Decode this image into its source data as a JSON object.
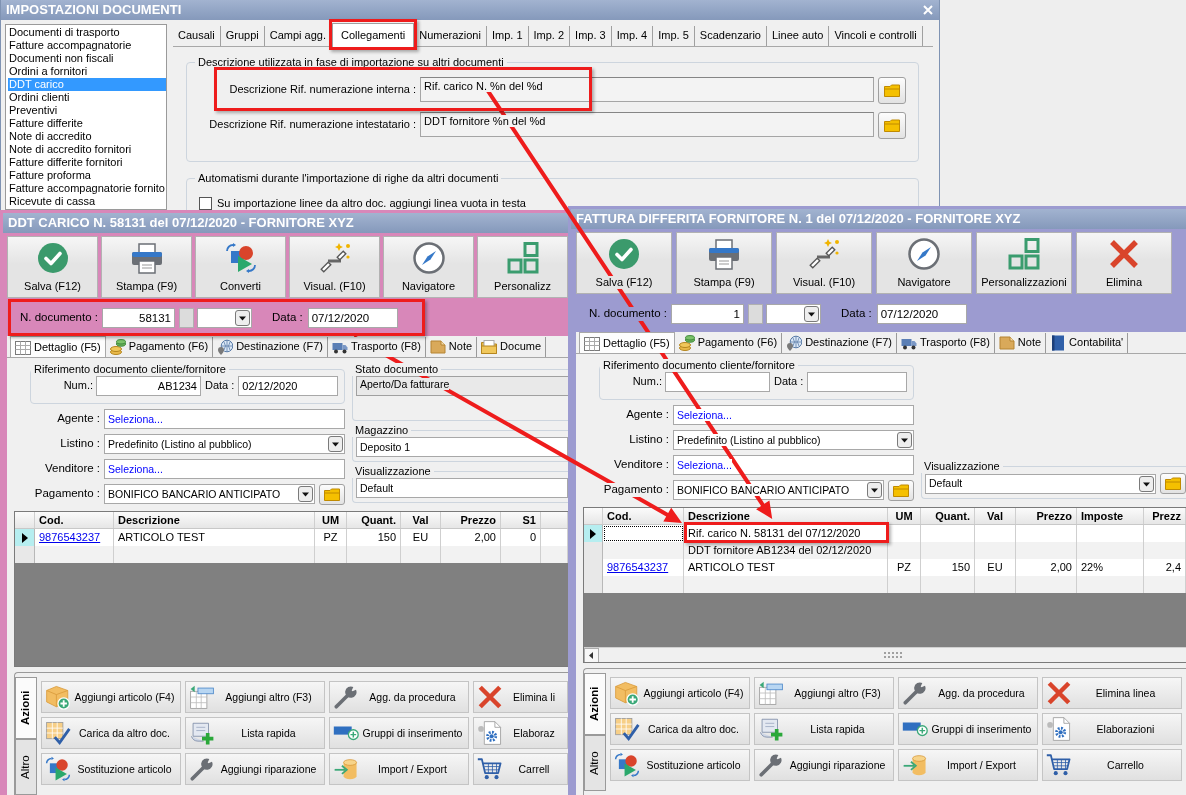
{
  "settings_window": {
    "title": "IMPOSTAZIONI DOCUMENTI",
    "document_types": [
      {
        "label": "Documenti di trasporto",
        "selected": false
      },
      {
        "label": "Fatture accompagnatorie",
        "selected": false
      },
      {
        "label": "Documenti non fiscali",
        "selected": false
      },
      {
        "label": "Ordini a fornitori",
        "selected": false
      },
      {
        "label": "DDT carico",
        "selected": true
      },
      {
        "label": "Ordini clienti",
        "selected": false
      },
      {
        "label": "Preventivi",
        "selected": false
      },
      {
        "label": "Fatture differite",
        "selected": false
      },
      {
        "label": "Note di accredito",
        "selected": false
      },
      {
        "label": "Note di accredito fornitori",
        "selected": false
      },
      {
        "label": "Fatture differite fornitori",
        "selected": false
      },
      {
        "label": "Fatture proforma",
        "selected": false
      },
      {
        "label": "Fatture accompagnatorie fornito",
        "selected": false
      },
      {
        "label": "Ricevute di cassa",
        "selected": false
      }
    ],
    "tabs": [
      {
        "label": "Causali",
        "selected": false,
        "highlighted": false
      },
      {
        "label": "Gruppi",
        "selected": false,
        "highlighted": false
      },
      {
        "label": "Campi agg.",
        "selected": false,
        "highlighted": false
      },
      {
        "label": "Collegamenti",
        "selected": true,
        "highlighted": true
      },
      {
        "label": "Numerazioni",
        "selected": false,
        "highlighted": false
      },
      {
        "label": "Imp. 1",
        "selected": false,
        "highlighted": false
      },
      {
        "label": "Imp. 2",
        "selected": false,
        "highlighted": false
      },
      {
        "label": "Imp. 3",
        "selected": false,
        "highlighted": false
      },
      {
        "label": "Imp. 4",
        "selected": false,
        "highlighted": false
      },
      {
        "label": "Imp. 5",
        "selected": false,
        "highlighted": false
      },
      {
        "label": "Scadenzario",
        "selected": false,
        "highlighted": false
      },
      {
        "label": "Linee auto",
        "selected": false,
        "highlighted": false
      },
      {
        "label": "Vincoli e controlli",
        "selected": false,
        "highlighted": false
      }
    ],
    "groups": [
      {
        "title": "Descrizione utilizzata in fase di importazione su altri documenti",
        "fields": [
          {
            "label": "Descrizione Rif. numerazione interna :",
            "value": "Rif. carico N. %n del %d",
            "highlighted": true,
            "arrow": true
          },
          {
            "label": "Descrizione Rif. numerazione intestatario :",
            "value": "DDT fornitore %n del %d",
            "highlighted": false,
            "arrow": false
          }
        ]
      },
      {
        "title": "Automatismi durante l'importazione di righe da altri documenti",
        "checkboxes": [
          {
            "label": "Su importazione linee da altro doc. aggiungi linea vuota in testa",
            "checked": false
          }
        ]
      }
    ]
  },
  "document_windows": [
    {
      "title": "DDT CARICO N. 58131 del 07/12/2020 - FORNITORE XYZ",
      "color": "#d887b9",
      "toolbar": [
        "Salva (F12)",
        "Stampa (F9)",
        "Converti",
        "Visual. (F10)",
        "Navigatore",
        "Personalizz"
      ],
      "header": {
        "number_label": "N. documento :",
        "number": "58131",
        "date_label": "Data :",
        "date": "07/12/2020",
        "highlighted": true,
        "arrow": true
      },
      "tabs": [
        {
          "label": "Dettaglio (F5)",
          "selected": true
        },
        {
          "label": "Pagamento (F6)",
          "selected": false
        },
        {
          "label": "Destinazione (F7)",
          "selected": false
        },
        {
          "label": "Trasporto (F8)",
          "selected": false
        },
        {
          "label": "Note",
          "selected": false
        },
        {
          "label": "Docume",
          "selected": false
        }
      ],
      "reference": {
        "title": "Riferimento documento cliente/fornitore",
        "number_label": "Num.:",
        "number": "AB1234",
        "date_label": "Data :",
        "date": "02/12/2020"
      },
      "fields": [
        {
          "label": "Agente :",
          "value": "Seleziona...",
          "kind": "selector"
        },
        {
          "label": "Listino :",
          "value": "Predefinito (Listino al pubblico)",
          "kind": "dropdown"
        },
        {
          "label": "Venditore :",
          "value": "Seleziona...",
          "kind": "selector"
        },
        {
          "label": "Pagamento :",
          "value": "BONIFICO BANCARIO ANTICIPATO",
          "kind": "dropdown",
          "folder_button": true
        }
      ],
      "side_groups": [
        {
          "title": "Stato documento",
          "value": "Aperto/Da fatturare",
          "kind": "readonly"
        },
        {
          "title": "Magazzino",
          "value": "Deposito 1",
          "kind": "field"
        },
        {
          "title": "Visualizzazione",
          "value": "Default",
          "kind": "field"
        }
      ],
      "grid": {
        "columns": [
          {
            "label": "Cod.",
            "kind": "link"
          },
          {
            "label": "Descrizione",
            "kind": "text"
          },
          {
            "label": "UM",
            "kind": "center"
          },
          {
            "label": "Quant.",
            "kind": "number"
          },
          {
            "label": "Val",
            "kind": "center"
          },
          {
            "label": "Prezzo",
            "kind": "number"
          },
          {
            "label": "S1",
            "kind": "number"
          }
        ],
        "rows": [
          {
            "current": true,
            "highlighted": false,
            "cells": [
              "9876543237",
              "ARTICOLO TEST",
              "PZ",
              "150",
              "EU",
              "2,00",
              "0"
            ]
          },
          {
            "current": false,
            "highlighted": false
          }
        ]
      },
      "action_tabs": [
        {
          "label": "Azioni",
          "selected": true
        },
        {
          "label": "Altro",
          "selected": false
        }
      ],
      "actions": [
        "Aggiungi articolo (F4)",
        "Aggiungi altro (F3)",
        "Agg. da procedura",
        "Elimina li",
        "Carica da altro doc.",
        "Lista rapida",
        "Gruppi di inserimento",
        "Elaboraz",
        "Sostituzione articolo",
        "Aggiungi riparazione",
        "Import / Export",
        "Carrell"
      ]
    },
    {
      "title": "FATTURA DIFFERITA FORNITORE N. 1 del 07/12/2020 - FORNITORE XYZ",
      "color": "#9c9bd0",
      "toolbar": [
        "Salva (F12)",
        "Stampa (F9)",
        "Visual. (F10)",
        "Navigatore",
        "Personalizzazioni",
        "Elimina"
      ],
      "header": {
        "number_label": "N. documento :",
        "number": "1",
        "date_label": "Data :",
        "date": "07/12/2020",
        "highlighted": false,
        "arrow": false
      },
      "tabs": [
        {
          "label": "Dettaglio (F5)",
          "selected": true
        },
        {
          "label": "Pagamento (F6)",
          "selected": false
        },
        {
          "label": "Destinazione (F7)",
          "selected": false
        },
        {
          "label": "Trasporto (F8)",
          "selected": false
        },
        {
          "label": "Note",
          "selected": false
        },
        {
          "label": "Contabilita'",
          "selected": false
        }
      ],
      "reference": {
        "title": "Riferimento documento cliente/fornitore",
        "number_label": "Num.:",
        "date_label": "Data :"
      },
      "fields": [
        {
          "label": "Agente :",
          "value": "Seleziona...",
          "kind": "selector"
        },
        {
          "label": "Listino :",
          "value": "Predefinito (Listino al pubblico)",
          "kind": "dropdown"
        },
        {
          "label": "Venditore :",
          "value": "Seleziona...",
          "kind": "selector"
        },
        {
          "label": "Pagamento :",
          "value": "BONIFICO BANCARIO ANTICIPATO",
          "kind": "dropdown",
          "folder_button": true
        }
      ],
      "side_groups": [
        {
          "title": "Visualizzazione",
          "value": "Default",
          "kind": "dropdown",
          "folder_button": true
        }
      ],
      "grid": {
        "columns": [
          {
            "label": "Cod.",
            "kind": "link"
          },
          {
            "label": "Descrizione",
            "kind": "text"
          },
          {
            "label": "UM",
            "kind": "center"
          },
          {
            "label": "Quant.",
            "kind": "number"
          },
          {
            "label": "Val",
            "kind": "center"
          },
          {
            "label": "Prezzo",
            "kind": "number"
          },
          {
            "label": "Imposte",
            "kind": "text"
          },
          {
            "label": "Prezz",
            "kind": "number"
          }
        ],
        "horizontal_scrollbar": true,
        "rows": [
          {
            "current": true,
            "focused": true,
            "highlighted": true,
            "cells": [
              null,
              "Rif. carico N. 58131 del 07/12/2020"
            ]
          },
          {
            "current": false,
            "focused": false,
            "highlighted": false,
            "cells": [
              null,
              "DDT fornitore AB1234 del 02/12/2020"
            ]
          },
          {
            "current": false,
            "focused": false,
            "highlighted": false,
            "cells": [
              "9876543237",
              "ARTICOLO TEST",
              "PZ",
              "150",
              "EU",
              "2,00",
              "22%",
              "2,4"
            ]
          },
          {
            "current": false,
            "focused": false,
            "highlighted": false
          }
        ]
      },
      "action_tabs": [
        {
          "label": "Azioni",
          "selected": true
        },
        {
          "label": "Altro",
          "selected": false
        }
      ],
      "actions": [
        "Aggiungi articolo (F4)",
        "Aggiungi altro (F3)",
        "Agg. da procedura",
        "Elimina linea",
        "Carica da altro doc.",
        "Lista rapida",
        "Gruppi di inserimento",
        "Elaborazioni",
        "Sostituzione articolo",
        "Aggiungi riparazione",
        "Import / Export",
        "Carrello"
      ]
    }
  ]
}
